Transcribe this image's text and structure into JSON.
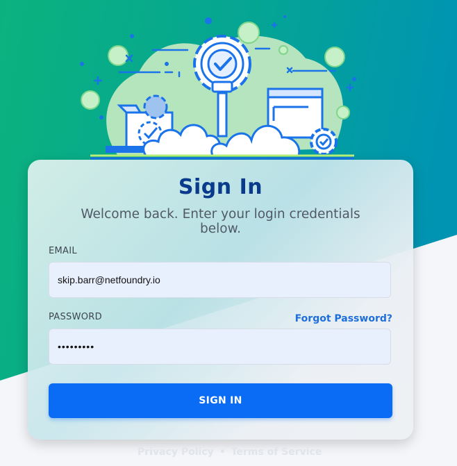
{
  "colors": {
    "bg_green": "#10b27d",
    "bg_teal": "#0094b0",
    "title": "#0a3a8c",
    "button": "#0a6cf5",
    "link": "#1e6fd9"
  },
  "login": {
    "title": "Sign In",
    "subtitle": "Welcome back. Enter your login credentials below.",
    "email_label": "EMAIL",
    "email_value": "skip.barr@netfoundry.io",
    "password_label": "PASSWORD",
    "password_value": "*********",
    "forgot_link": "Forgot Password?",
    "submit_label": "SIGN IN"
  },
  "footer": {
    "privacy": "Privacy Policy",
    "separator": "•",
    "terms": "Terms of Service"
  },
  "hero": {
    "icons": [
      "lightbulb-gear-icon",
      "rocket-icon",
      "browser-window-icon",
      "cloud-icon",
      "box-icon",
      "gear-icon",
      "check-icon"
    ]
  }
}
